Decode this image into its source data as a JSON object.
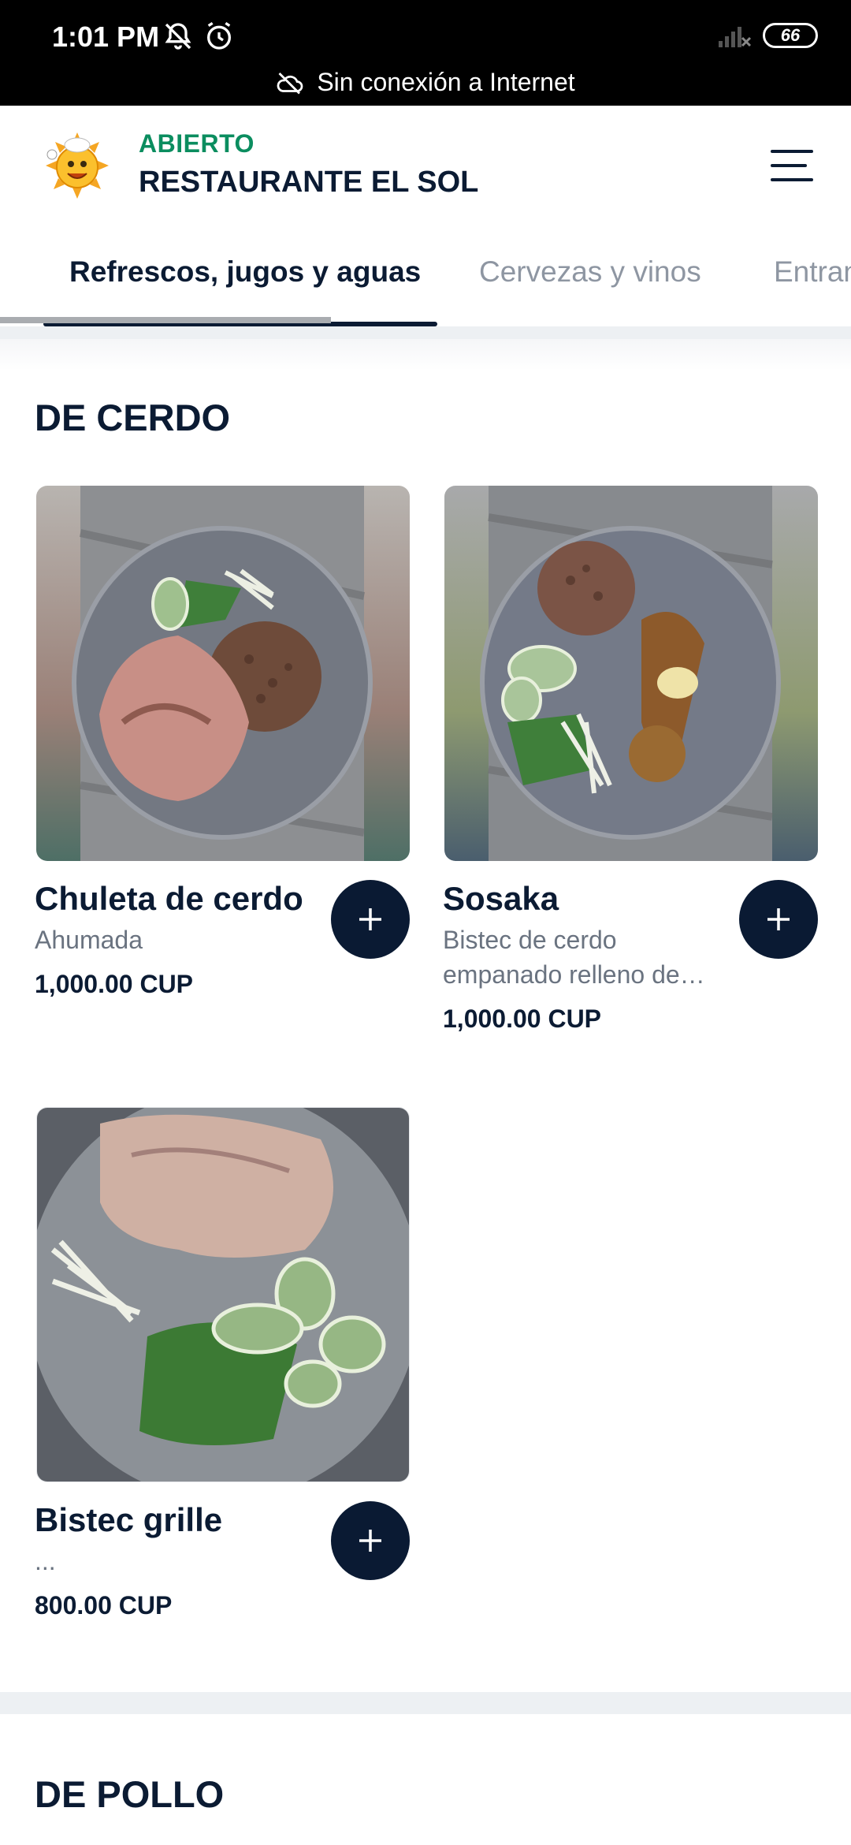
{
  "status_bar": {
    "time": "1:01 PM",
    "battery": "66",
    "offline_message": "Sin conexión a Internet"
  },
  "header": {
    "status": "ABIERTO",
    "restaurant_name": "RESTAURANTE EL SOL"
  },
  "tabs": [
    {
      "label": "Refrescos, jugos y aguas"
    },
    {
      "label": "Cervezas y vinos"
    },
    {
      "label": "Entrantes"
    }
  ],
  "sections": [
    {
      "title": "DE CERDO",
      "items": [
        {
          "name": "Chuleta de cerdo",
          "description": "Ahumada",
          "price": "1,000.00 CUP"
        },
        {
          "name": "Sosaka",
          "description": "Bistec de cerdo empanado relleno de…",
          "price": "1,000.00 CUP"
        },
        {
          "name": "Bistec grille",
          "description": "...",
          "price": "800.00 CUP"
        }
      ]
    },
    {
      "title": "DE POLLO",
      "items": []
    }
  ],
  "colors": {
    "primary": "#0b1b33",
    "open_status": "#0b8d5f",
    "muted": "#8e96a2",
    "add_button": "#0a1a33"
  },
  "icons": {
    "mute": "bell-off-icon",
    "alarm": "alarm-icon",
    "signal": "signal-off-icon",
    "cloud": "cloud-off-icon",
    "menu": "menu-icon",
    "add": "plus-icon"
  }
}
